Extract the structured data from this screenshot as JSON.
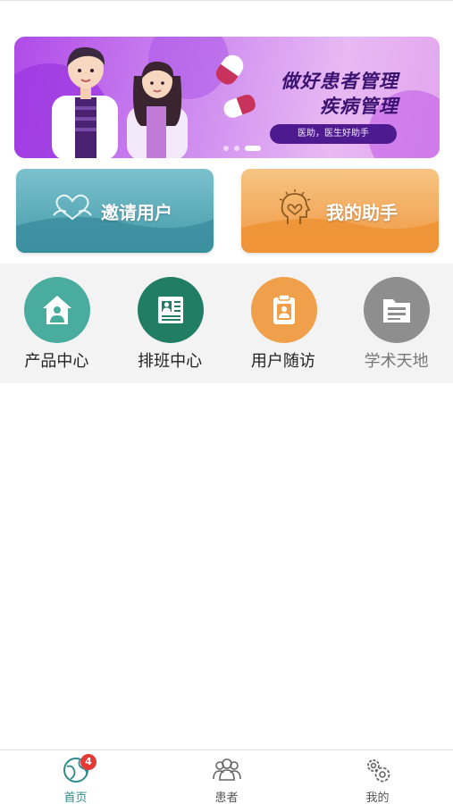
{
  "banner": {
    "title_line1": "做好患者管理",
    "title_line2": "疾病管理",
    "tag": "医助，医生好助手",
    "slide_count": 3,
    "active_slide": 2
  },
  "cards": {
    "invite_label": "邀请用户",
    "helper_label": "我的助手"
  },
  "grid": [
    {
      "label": "产品中心",
      "icon": "house-icon",
      "color": "#4aab9f"
    },
    {
      "label": "排班中心",
      "icon": "schedule-book-icon",
      "color": "#217d63"
    },
    {
      "label": "用户随访",
      "icon": "clipboard-user-icon",
      "color": "#f0a04b"
    },
    {
      "label": "学术天地",
      "icon": "folder-icon",
      "color": "#8e8e8e"
    }
  ],
  "tabbar": {
    "home_label": "首页",
    "home_badge": "4",
    "patients_label": "患者",
    "mine_label": "我的"
  }
}
